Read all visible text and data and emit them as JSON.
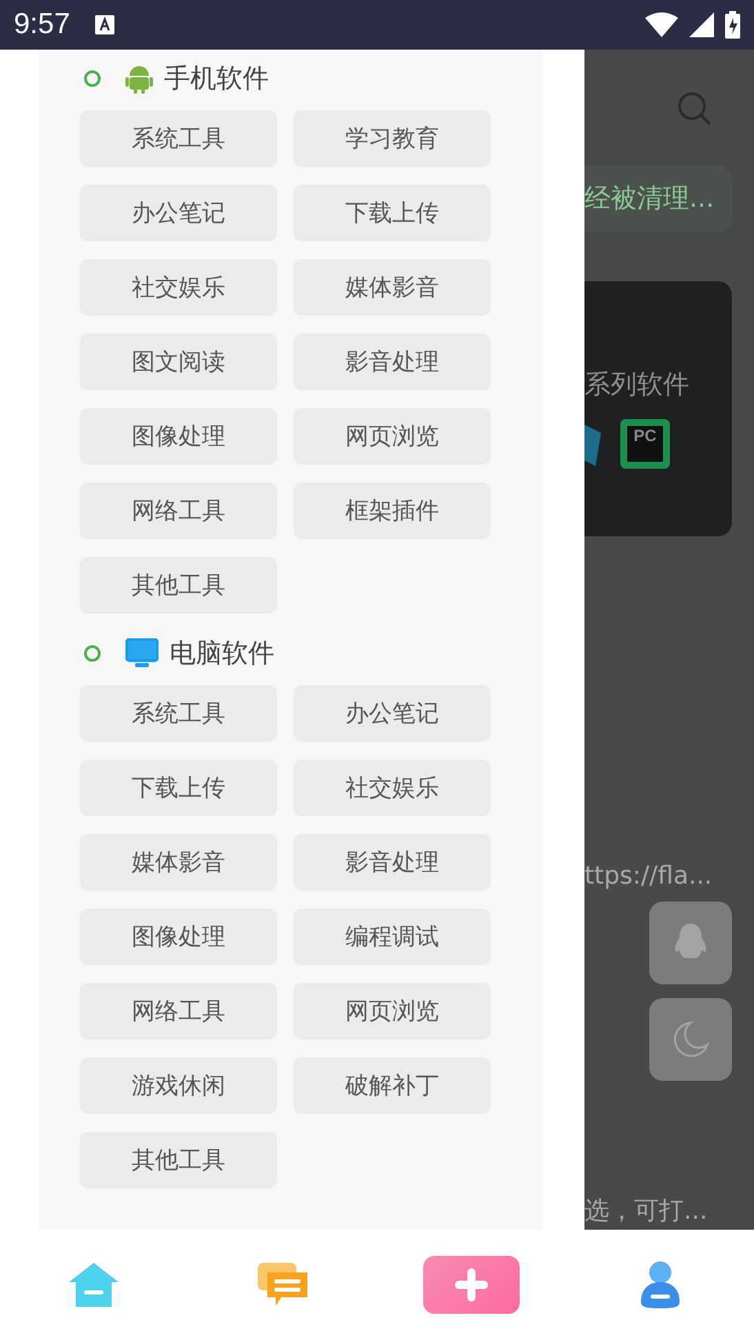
{
  "status_bar": {
    "time": "9:57"
  },
  "categories": [
    {
      "title": "手机软件",
      "kind": "android",
      "items": [
        "系统工具",
        "学习教育",
        "办公笔记",
        "下载上传",
        "社交娱乐",
        "媒体影音",
        "图文阅读",
        "影音处理",
        "图像处理",
        "网页浏览",
        "网络工具",
        "框架插件",
        "其他工具"
      ]
    },
    {
      "title": "电脑软件",
      "kind": "monitor",
      "items": [
        "系统工具",
        "办公笔记",
        "下载上传",
        "社交娱乐",
        "媒体影音",
        "影音处理",
        "图像处理",
        "编程调试",
        "网络工具",
        "网页浏览",
        "游戏休闲",
        "破解补丁",
        "其他工具"
      ]
    }
  ],
  "background_page": {
    "notice": "经被清理...",
    "card_text": "系列软件",
    "card_logo": "PC",
    "link": "ttps://fla...",
    "footer_text": "选，可打..."
  },
  "bottom_nav": [
    {
      "kind": "home"
    },
    {
      "kind": "chat"
    },
    {
      "kind": "add"
    },
    {
      "kind": "user"
    }
  ]
}
